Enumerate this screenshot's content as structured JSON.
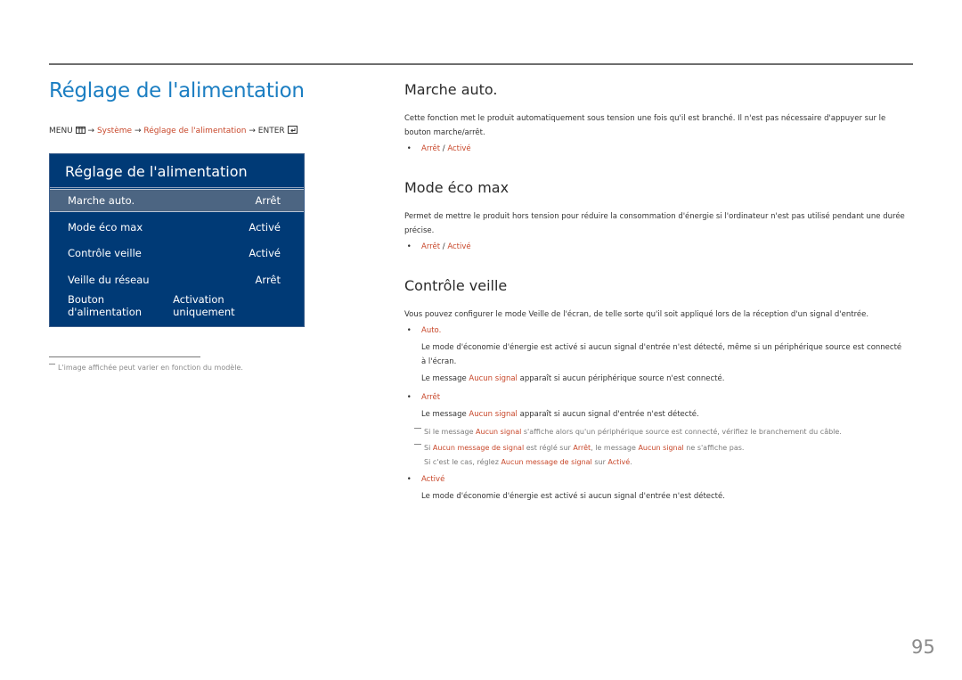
{
  "page": {
    "title": "Réglage de l'alimentation",
    "page_number": "95"
  },
  "breadcrumb": {
    "menu": "MENU",
    "menu_icon": "menu-grid-icon",
    "arrow": "→",
    "system": "Système",
    "power": "Réglage de l'alimentation",
    "enter": "ENTER",
    "enter_icon": "enter-icon"
  },
  "osd": {
    "title": "Réglage de l'alimentation",
    "items": [
      {
        "label": "Marche auto.",
        "value": "Arrêt",
        "selected": true
      },
      {
        "label": "Mode éco max",
        "value": "Activé"
      },
      {
        "label": "Contrôle veille",
        "value": "Activé"
      },
      {
        "label": "Veille du réseau",
        "value": "Arrêt"
      },
      {
        "label": "Bouton d'alimentation",
        "value": "Activation uniquement"
      }
    ]
  },
  "footnote": "L'image affichée peut varier en fonction du modèle.",
  "sections": {
    "marche_auto": {
      "title": "Marche auto.",
      "description": "Cette fonction met le produit automatiquement sous tension une fois qu'il est branché. Il n'est pas nécessaire d'appuyer sur le bouton marche/arrêt.",
      "option_off": "Arrêt",
      "separator": " / ",
      "option_on": "Activé"
    },
    "mode_eco": {
      "title": "Mode éco max",
      "description": "Permet de mettre le produit hors tension pour réduire la consommation d'énergie si l'ordinateur n'est pas utilisé pendant une durée précise.",
      "option_off": "Arrêt",
      "separator": " / ",
      "option_on": "Activé"
    },
    "controle_veille": {
      "title": "Contrôle veille",
      "description": "Vous pouvez configurer le mode Veille de l'écran, de telle sorte qu'il soit appliqué lors de la réception d'un signal d'entrée.",
      "auto": {
        "label": "Auto.",
        "text1": "Le mode d'économie d'énergie est activé si aucun signal d'entrée n'est détecté, même si un périphérique source est connecté à l'écran.",
        "text2_pre": "Le message ",
        "text2_hl": "Aucun signal",
        "text2_post": " apparaît si aucun périphérique source n'est connecté."
      },
      "off": {
        "label": "Arrêt",
        "text_pre": "Le message ",
        "text_hl": "Aucun signal",
        "text_post": " apparaît si aucun signal d'entrée n'est détecté.",
        "note1_pre": "Si le message ",
        "note1_hl": "Aucun signal",
        "note1_post": " s'affiche alors qu'un périphérique source est connecté, vérifiez le branchement du câble.",
        "note2_a": "Si ",
        "note2_hl1": "Aucun message de signal",
        "note2_b": " est réglé sur ",
        "note2_hl2": "Arrêt",
        "note2_c": ", le message ",
        "note2_hl3": "Aucun signal",
        "note2_d": " ne s'affiche pas.",
        "note3_a": "Si c'est le cas, réglez ",
        "note3_hl1": "Aucun message de signal",
        "note3_b": " sur ",
        "note3_hl2": "Activé",
        "note3_c": "."
      },
      "on": {
        "label": "Activé",
        "text": "Le mode d'économie d'énergie est activé si aucun signal d'entrée n'est détecté."
      }
    }
  },
  "colors": {
    "title_blue": "#1b7ec2",
    "highlight_red": "#c8472a",
    "osd_bg": "#003a76",
    "osd_selected": "#4c6582"
  }
}
